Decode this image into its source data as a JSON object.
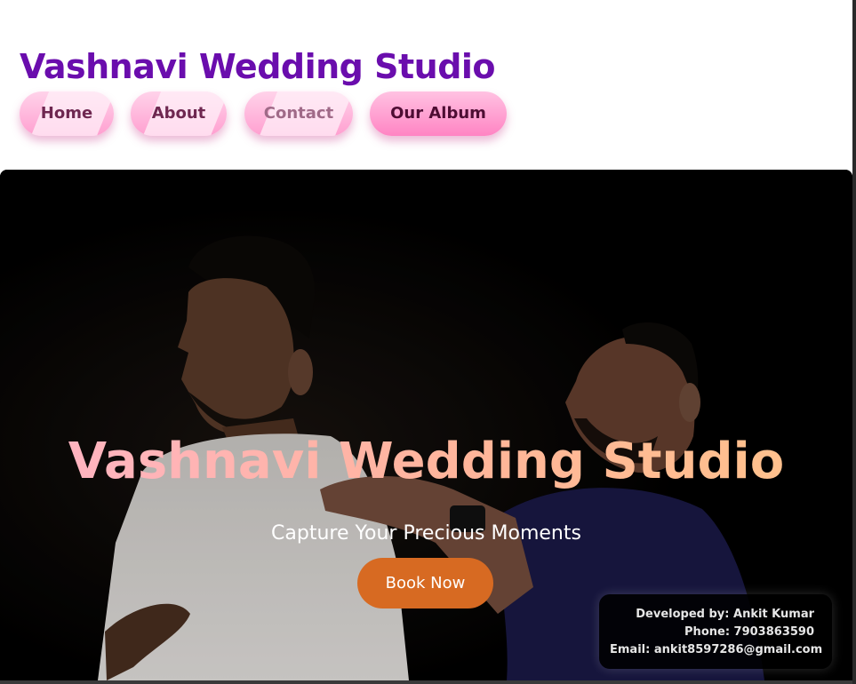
{
  "site": {
    "brand_title": "Vashnavi Wedding Studio"
  },
  "nav": {
    "items": [
      {
        "label": "Home"
      },
      {
        "label": "About"
      },
      {
        "label": "Contact"
      },
      {
        "label": "Our Album"
      }
    ]
  },
  "hero": {
    "title": "Vashnavi Wedding Studio",
    "subtitle": "Capture Your Precious Moments",
    "cta_label": "Book Now",
    "cta_color": "#d76a22"
  },
  "developer": {
    "name_line": "Developed by: Ankit Kumar",
    "phone_line": "Phone: 7903863590",
    "email_line": "Email: ankit8597286@gmail.com"
  },
  "colors": {
    "brand": "#6a0dad",
    "nav_pink": "#ff9fd0",
    "hero_bg": "#000000"
  }
}
